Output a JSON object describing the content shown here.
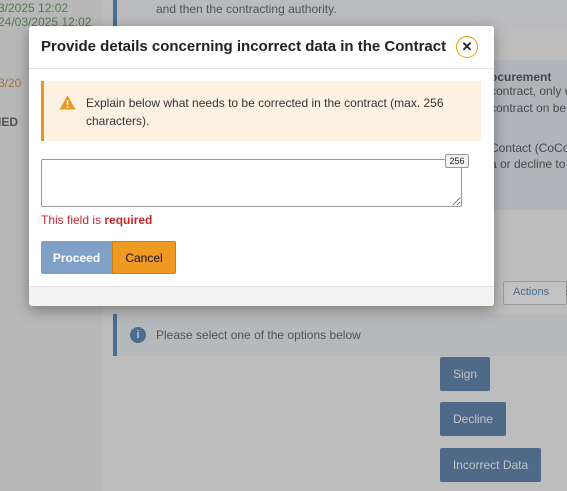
{
  "background": {
    "left_dates": [
      "3/2025 12:02",
      "24/03/2025 12:02",
      "3/20",
      "IED"
    ],
    "top_text": "and then the contracting authority.",
    "panel_lines": [
      "ocurement",
      "contract, only us",
      "contract on be",
      "Contact (CoCo",
      "a or decline to"
    ],
    "actions_label": "Actions",
    "info_text": "Please select one of the options below",
    "sign_label": "Sign",
    "decline_label": "Decline",
    "incorrect_data_label": "Incorrect Data"
  },
  "modal": {
    "title": "Provide details concerning incorrect data in the Contract",
    "close_icon": "close-icon",
    "warning_icon": "warning-triangle-icon",
    "warning_text": "Explain below what needs to be corrected in the contract (max. 256 characters).",
    "textarea_value": "",
    "char_counter": "256",
    "error_prefix": "This field is ",
    "error_emphasis": "required",
    "proceed_label": "Proceed",
    "cancel_label": "Cancel"
  },
  "colors": {
    "accent_blue": "#2e5f96",
    "warning_orange": "#e8961f",
    "cancel_orange": "#ef9a22",
    "proceed_blue": "#7fa1c8",
    "error_red": "#c62828"
  }
}
